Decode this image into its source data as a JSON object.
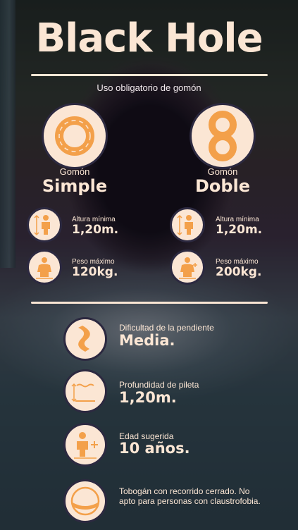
{
  "title": "Black Hole",
  "subtitle": "Uso obligatorio de gomón",
  "tubes": [
    {
      "label": "Gomón",
      "name": "Simple",
      "icon": "single-tube-icon",
      "height_label": "Altura mínima",
      "height_value": "1,20m.",
      "weight_label": "Peso máximo",
      "weight_value": "120kg."
    },
    {
      "label": "Gomón",
      "name": "Doble",
      "icon": "double-tube-icon",
      "height_label": "Altura mínima",
      "height_value": "1,20m.",
      "weight_label": "Peso máximo",
      "weight_value": "200kg."
    }
  ],
  "features": [
    {
      "icon": "slope-icon",
      "label": "Dificultad de la pendiente",
      "value": "Media."
    },
    {
      "icon": "pool-depth-icon",
      "label": "Profundidad de pileta",
      "value": "1,20m."
    },
    {
      "icon": "age-icon",
      "label": "Edad sugerida",
      "value": "10 años."
    },
    {
      "icon": "closed-tube-icon",
      "note": "Tobogán con recorrido cerrado. No apto para personas con claustrofobia."
    }
  ],
  "colors": {
    "accent": "#f3a04a",
    "cream": "#fbe6d4",
    "ring": "#2c2940"
  }
}
